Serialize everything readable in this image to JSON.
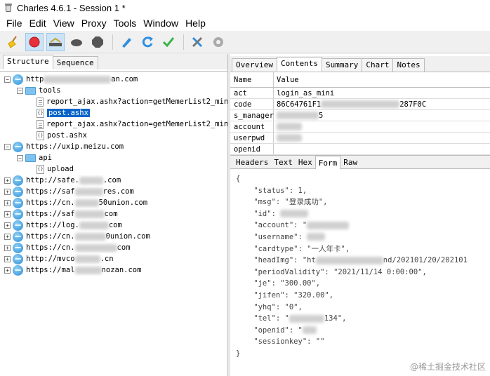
{
  "window": {
    "title": "Charles 4.6.1 - Session 1 *"
  },
  "menu": [
    "File",
    "Edit",
    "View",
    "Proxy",
    "Tools",
    "Window",
    "Help"
  ],
  "toolbar": {
    "icons": [
      "broom-icon",
      "record-icon",
      "throttle-icon",
      "breakpoint-icon",
      "stop-icon",
      "pen-icon",
      "refresh-icon",
      "check-icon",
      "tools-icon",
      "settings-icon"
    ]
  },
  "left_tabs": [
    "Structure",
    "Sequence"
  ],
  "tree": {
    "hosts": [
      {
        "prefix": "http",
        "suffix": "an.com"
      },
      {
        "folder": "tools"
      },
      {
        "file": "report_ajax.ashx?action=getMemerList2_mini"
      },
      {
        "file": "post.ashx"
      },
      {
        "file": "report_ajax.ashx?action=getMemerList2_mini"
      },
      {
        "file": "post.ashx"
      },
      {
        "url": "https://uxip.meizu.com"
      },
      {
        "folder": "api"
      },
      {
        "file": "upload"
      },
      {
        "prefix": "http://safe.",
        "suffix": ".com"
      },
      {
        "prefix": "https://saf",
        "suffix": "res.com"
      },
      {
        "prefix": "https://cn.",
        "suffix": "50union.com"
      },
      {
        "prefix": "https://saf",
        "suffix": "com"
      },
      {
        "prefix": "https://log.",
        "suffix": "com"
      },
      {
        "prefix": "https://cn.",
        "suffix": "0union.com"
      },
      {
        "prefix": "https://cn.",
        "suffix": "com"
      },
      {
        "prefix": "http://mvco",
        "suffix": ".cn"
      },
      {
        "prefix": "https://mal",
        "suffix": "nozan.com"
      }
    ]
  },
  "right_tabs": [
    "Overview",
    "Contents",
    "Summary",
    "Chart",
    "Notes"
  ],
  "form_grid": {
    "headers": [
      "Name",
      "Value"
    ],
    "rows": [
      {
        "name": "act",
        "value": "login_as_mini"
      },
      {
        "name": "code",
        "value": "86C64761F1",
        "value_end": "287F0C"
      },
      {
        "name": "s_manager",
        "value": "",
        "value_end": "5"
      },
      {
        "name": "account",
        "value": ""
      },
      {
        "name": "userpwd",
        "value": ""
      },
      {
        "name": "openid",
        "value": ""
      }
    ]
  },
  "sub_tabs": [
    "Headers",
    "Text",
    "Hex",
    "Form",
    "Raw"
  ],
  "json_lines": [
    "{",
    "    \"status\": 1,",
    "    \"msg\": \"登录成功\",",
    "    \"id\": ",
    "    \"account\": \"",
    "    \"username\": ",
    "    \"cardtype\": \"一人年卡\",",
    "    \"headImg\": \"ht",
    "    \"periodValidity\": \"2021/11/14 0:00:00\",",
    "    \"je\": \"300.00\",",
    "    \"jifen\": \"320.00\",",
    "    \"yhq\": \"0\",",
    "    \"tel\": \"",
    "    \"openid\": \"",
    "    \"sessionkey\": \"\"",
    "}"
  ],
  "json_tails": {
    "headImg": "nd/202101/20/202101",
    "tel": "134\","
  },
  "watermark": "@稀土掘金技术社区"
}
